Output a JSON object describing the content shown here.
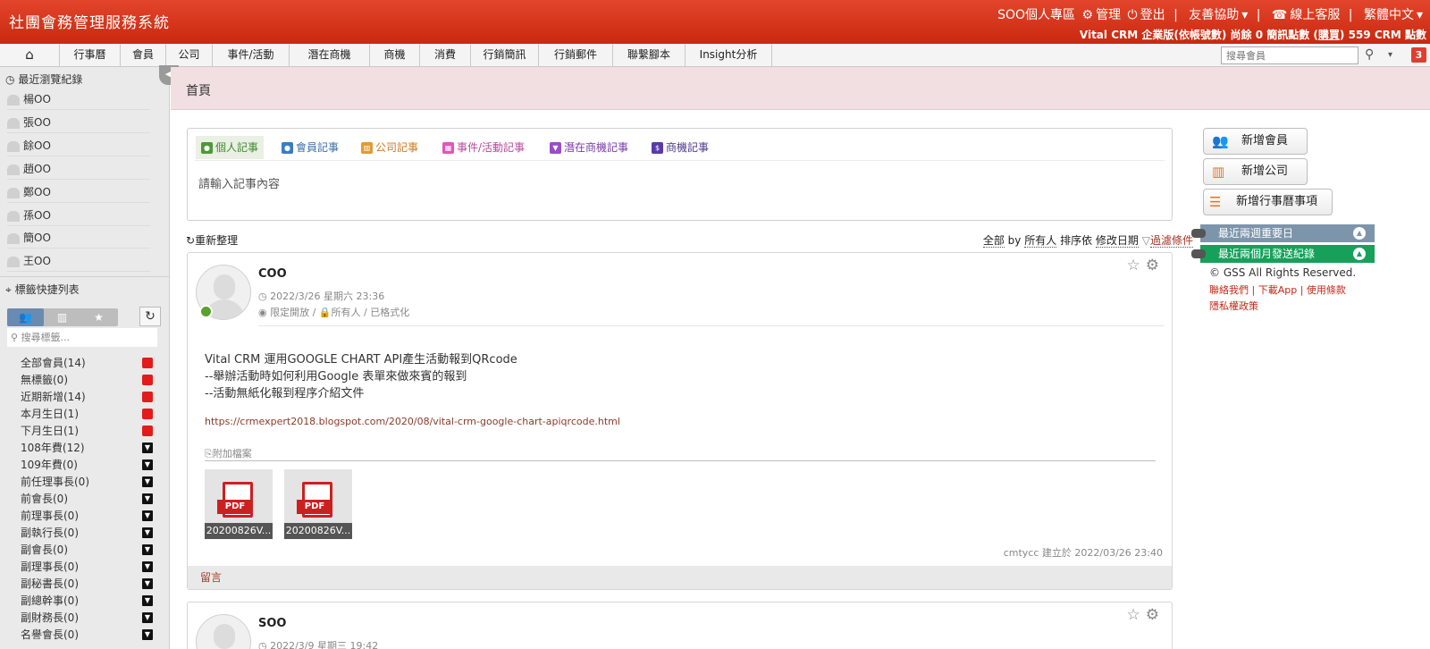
{
  "header": {
    "title": "社團會務管理服務系統",
    "user_area": "SOO個人專區",
    "admin": "管理",
    "logout": "登出",
    "partner": "友善協助",
    "online_support": "線上客服",
    "language": "繁體中文",
    "account_info": "Vital CRM 企業版(依帳號數)",
    "sms_label": "尚餘 0 簡訊點數",
    "buy_label": "購買",
    "crm_points": "559 CRM 點數"
  },
  "nav": {
    "items": [
      "行事曆",
      "會員",
      "公司",
      "事件/活動",
      "潛在商機",
      "商機",
      "消費",
      "行銷簡訊",
      "行銷郵件",
      "聯繫腳本",
      "Insight分析"
    ],
    "search_placeholder": "搜尋會員",
    "notification_count": "3"
  },
  "sidebar": {
    "recent_title": "最近瀏覽紀錄",
    "recent_items": [
      "楊OO",
      "張OO",
      "餘OO",
      "趙OO",
      "鄭OO",
      "孫OO",
      "簡OO",
      "王OO"
    ],
    "tags_title": "標籤快捷列表",
    "tag_search_placeholder": "搜尋標籤...",
    "tags": [
      {
        "label": "全部會員(14)",
        "marker": "red"
      },
      {
        "label": "無標籤(0)",
        "marker": "red"
      },
      {
        "label": "近期新增(14)",
        "marker": "red"
      },
      {
        "label": "本月生日(1)",
        "marker": "red"
      },
      {
        "label": "下月生日(1)",
        "marker": "red"
      },
      {
        "label": "108年費(12)",
        "marker": "tri"
      },
      {
        "label": "109年費(0)",
        "marker": "tri"
      },
      {
        "label": "前任理事長(0)",
        "marker": "tri"
      },
      {
        "label": "前會長(0)",
        "marker": "tri"
      },
      {
        "label": "前理事長(0)",
        "marker": "tri"
      },
      {
        "label": "副執行長(0)",
        "marker": "tri"
      },
      {
        "label": "副會長(0)",
        "marker": "tri"
      },
      {
        "label": "副理事長(0)",
        "marker": "tri"
      },
      {
        "label": "副秘書長(0)",
        "marker": "tri"
      },
      {
        "label": "副總幹事(0)",
        "marker": "tri"
      },
      {
        "label": "副財務長(0)",
        "marker": "tri"
      },
      {
        "label": "名譽會長(0)",
        "marker": "tri"
      }
    ]
  },
  "breadcrumb": "首頁",
  "composer": {
    "tabs": [
      "個人記事",
      "會員記事",
      "公司記事",
      "事件/活動記事",
      "潛在商機記事",
      "商機記事"
    ],
    "placeholder": "請輸入記事內容"
  },
  "actions": {
    "add_member": "新增會員",
    "add_company": "新增公司",
    "add_calendar": "新增行事曆事項"
  },
  "feed": {
    "refresh": "重新整理",
    "filter_all": "全部",
    "filter_by": "by",
    "filter_owner": "所有人",
    "sort_by": "排序依",
    "sort_field": "修改日期",
    "filter_conditions": "過濾條件"
  },
  "posts": [
    {
      "name": "COO",
      "date": "2022/3/26 星期六 23:36",
      "visibility": "限定開放 / ",
      "visibility_owner": "所有人",
      "visibility_format": " / 已格式化",
      "line1": "Vital CRM 運用GOOGLE CHART API產生活動報到QRcode",
      "line2": "--舉辦活動時如何利用Google 表單來做來賓的報到",
      "line3": "--活動無紙化報到程序介紹文件",
      "link": "https://crmexpert2018.blogspot.com/2020/08/vital-crm-google-chart-apiqrcode.html",
      "attach_label": "附加檔案",
      "files": [
        "20200826V...",
        "20200826V..."
      ],
      "meta": "cmtycc 建立於 2022/03/26 23:40",
      "comment": "留言"
    },
    {
      "name": "SOO",
      "date": "2022/3/9 星期三 19:42"
    }
  ],
  "right_panel": {
    "important_days": "最近兩週重要日",
    "sent_records": "最近兩個月發送紀錄",
    "copyright": "© GSS All Rights Reserved.",
    "contact": "聯絡我們",
    "download": "下載App",
    "terms": "使用條款",
    "privacy": "隱私權政策"
  },
  "colors": {
    "header": "#d5341b",
    "important_days_bg": "#7d95ab",
    "sent_records_bg": "#17a05a",
    "link_red": "#a9392b"
  }
}
